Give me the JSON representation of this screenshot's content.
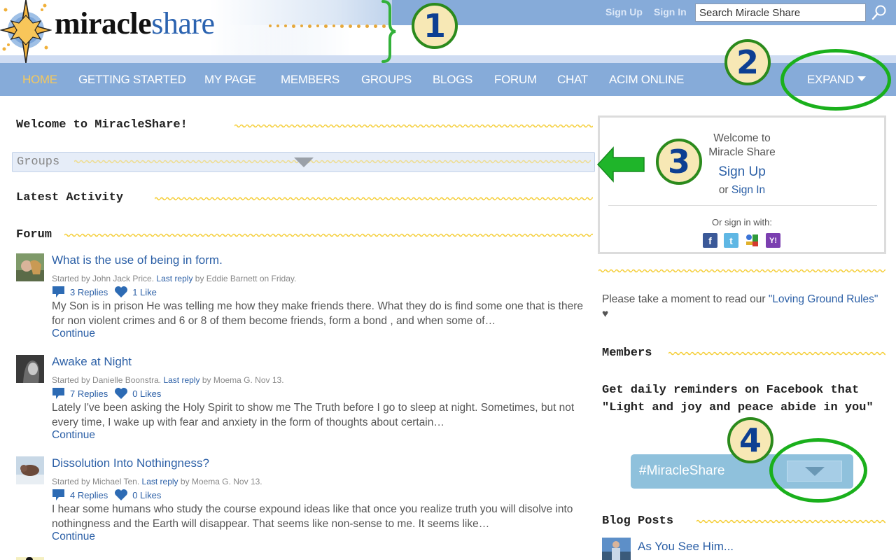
{
  "header": {
    "logo": {
      "part1": "miracle",
      "part2": "share"
    },
    "sign_up": "Sign Up",
    "sign_in": "Sign In",
    "search_placeholder": "Search Miracle Share"
  },
  "nav": {
    "items": [
      {
        "label": "HOME",
        "active": true
      },
      {
        "label": "GETTING STARTED"
      },
      {
        "label": "MY PAGE"
      },
      {
        "label": "MEMBERS"
      },
      {
        "label": "GROUPS"
      },
      {
        "label": "BLOGS"
      },
      {
        "label": "FORUM"
      },
      {
        "label": "CHAT"
      },
      {
        "label": "ACIM ONLINE"
      }
    ],
    "expand": "EXPAND"
  },
  "main": {
    "welcome_title": "Welcome to MiracleShare!",
    "groups_title": "Groups",
    "latest_activity_title": "Latest Activity",
    "forum_title": "Forum",
    "posts": [
      {
        "title": "What is the use of being in form.",
        "started_by": "Started by John Jack Price.",
        "last_reply_label": "Last reply",
        "last_reply_by": "by Eddie Barnett on Friday.",
        "replies": "3 Replies",
        "likes": "1 Like",
        "excerpt": "My Son is in prison He was telling me how they make friends there. What they do is find some one that is there for non violent crimes and 6 or 8 of them become friends, form a bond , and when some of…",
        "continue": "Continue"
      },
      {
        "title": "Awake at Night",
        "started_by": "Started by Danielle Boonstra.",
        "last_reply_label": "Last reply",
        "last_reply_by": "by Moema G. Nov 13.",
        "replies": "7 Replies",
        "likes": "0 Likes",
        "excerpt": "Lately I've been asking the Holy Spirit to show me The Truth before I go to sleep at night. Sometimes, but not every time, I wake up with fear and anxiety in the form of thoughts about certain…",
        "continue": "Continue"
      },
      {
        "title": "Dissolution Into Nothingness?",
        "started_by": "Started by Michael Ten.",
        "last_reply_label": "Last reply",
        "last_reply_by": "by Moema G. Nov 13.",
        "replies": "4 Replies",
        "likes": "0 Likes",
        "excerpt": "I hear some humans who study the course expound ideas like that once you realize truth you will disolve into nothingness and the Earth will disappear. That seems like non-sense to me. It seems like…",
        "continue": "Continue"
      }
    ]
  },
  "sidebar": {
    "signin_box": {
      "welcome_line1": "Welcome to",
      "welcome_line2": "Miracle Share",
      "sign_up": "Sign Up",
      "or": "or",
      "sign_in": "Sign In",
      "or_sign_in_with": "Or sign in with:",
      "providers": [
        "facebook",
        "twitter",
        "google",
        "yahoo"
      ]
    },
    "rules_prefix": "Please take a moment to read our ",
    "rules_link": "\"Loving Ground Rules\"",
    "rules_suffix": " ♥",
    "members_title": "Members",
    "reminder_text": "Get daily reminders on Facebook that \"Light and joy and peace abide in you\"",
    "hashtag": "#MiracleShare",
    "blog_posts_title": "Blog Posts",
    "blog_posts": [
      {
        "title": "As You See Him..."
      }
    ]
  },
  "annotations": {
    "badges": [
      "1",
      "2",
      "3",
      "4"
    ],
    "colors": {
      "ring": "#1ab01c",
      "badge_fill": "#f7e8b5",
      "badge_number": "#0d3f92"
    }
  },
  "colors": {
    "nav_bg": "#86abd9",
    "nav_active": "#f4c85e",
    "link": "#2b5fa6",
    "wavy_rule": "#f5cf3c"
  }
}
